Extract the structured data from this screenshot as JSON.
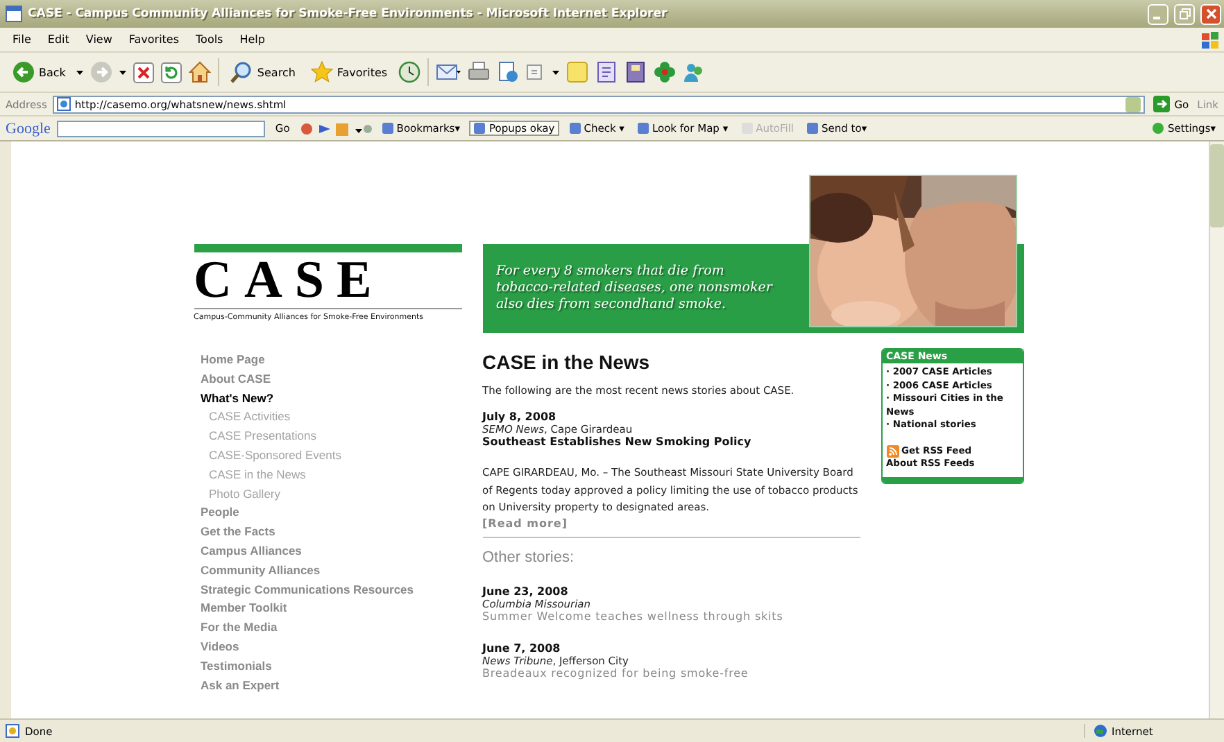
{
  "window": {
    "title": "CASE - Campus Community Alliances for Smoke-Free Environments - Microsoft Internet Explorer"
  },
  "menu": [
    "File",
    "Edit",
    "View",
    "Favorites",
    "Tools",
    "Help"
  ],
  "toolbar": [
    {
      "label": "Back",
      "kind": "back"
    },
    {
      "label": "Search",
      "kind": "search"
    },
    {
      "label": "Favorites",
      "kind": "favorites"
    }
  ],
  "address": {
    "label": "Address",
    "value": "http://casemo.org/whatsnew/news.shtml",
    "go": "Go",
    "links": "Link"
  },
  "google_bar": {
    "logo": "Google",
    "go": "Go",
    "items": [
      {
        "label": "Bookmarks▾",
        "disabled": false
      },
      {
        "label": "Popups okay",
        "disabled": false
      },
      {
        "label": "Check ▾",
        "disabled": false
      },
      {
        "label": "Look for Map ▾",
        "disabled": false
      },
      {
        "label": "AutoFill",
        "disabled": true
      },
      {
        "label": "Send to▾",
        "disabled": false
      }
    ],
    "settings": "Settings▾"
  },
  "page": {
    "logo": {
      "title": "CASE",
      "tagline": "Campus-Community Alliances for Smoke-Free Environments"
    },
    "banner": {
      "text": "For every 8 smokers that die from tobacco-related diseases, one nonsmoker also dies from secondhand smoke."
    },
    "nav": [
      {
        "label": "Home Page",
        "selected": false
      },
      {
        "label": "About CASE",
        "selected": false
      },
      {
        "label": "What's New?",
        "selected": true,
        "children": [
          {
            "label": "CASE Activities",
            "selected": false
          },
          {
            "label": "CASE Presentations",
            "selected": false
          },
          {
            "label": "CASE-Sponsored Events",
            "selected": false
          },
          {
            "label": "CASE in the News",
            "selected": false
          },
          {
            "label": "Photo Gallery",
            "selected": false
          }
        ]
      },
      {
        "label": "People",
        "selected": false
      },
      {
        "label": "Get the Facts",
        "selected": false
      },
      {
        "label": "Campus Alliances",
        "selected": false
      },
      {
        "label": "Community Alliances",
        "selected": false
      },
      {
        "label": "Strategic Communications Resources",
        "selected": false
      },
      {
        "label": "Member Toolkit",
        "selected": false
      },
      {
        "label": "For the Media",
        "selected": false
      },
      {
        "label": "Videos",
        "selected": false
      },
      {
        "label": "Testimonials",
        "selected": false
      },
      {
        "label": "Ask an Expert",
        "selected": false
      }
    ],
    "heading": "CASE in the News",
    "intro": "The following are the most recent news stories about CASE.",
    "featured": {
      "date": "July 8, 2008",
      "source": "*SEMO News*, Cape Girardeau",
      "headline": "Southeast Establishes New Smoking Policy",
      "body": "CAPE GIRARDEAU, Mo. – The Southeast Missouri State University Board of Regents today approved a policy limiting the use of tobacco products on University property to designated areas.",
      "more": "[Read more]"
    },
    "other_heading": "Other stories:",
    "stories": [
      {
        "date": "June 23, 2008",
        "source": "*Columbia Missourian*",
        "title": "Summer Welcome teaches wellness through skits"
      },
      {
        "date": "June 7, 2008",
        "source": "*News Tribune*, Jefferson City",
        "title": "Breadeaux recognized for being smoke-free"
      }
    ],
    "sidebar": {
      "title": "CASE News",
      "links": [
        "· 2007 CASE Articles",
        "· 2006 CASE Articles",
        "· Missouri Cities in the News",
        "· National stories"
      ],
      "rss": "Get RSS Feed",
      "about_rss": "About RSS Feeds"
    }
  },
  "status_bar": {
    "text": "Done",
    "zone": "Internet"
  }
}
